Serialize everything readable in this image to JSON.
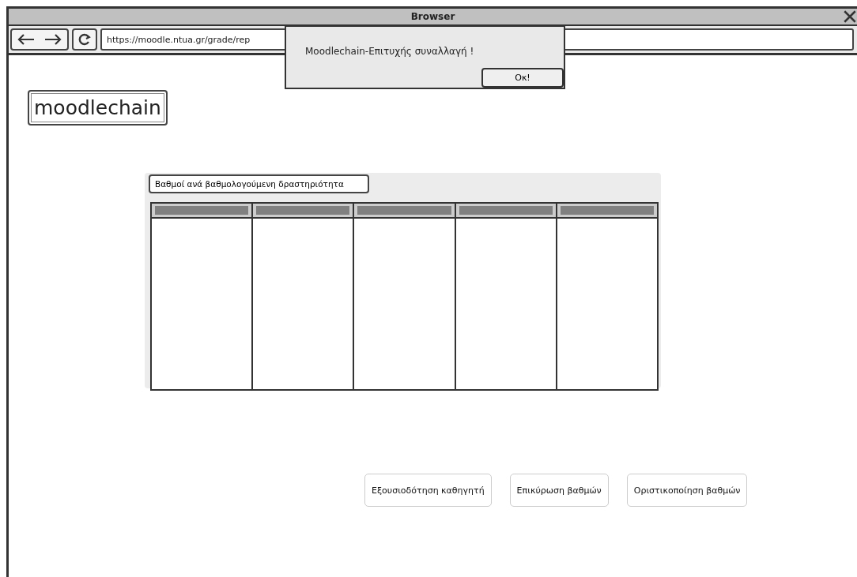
{
  "window": {
    "title": "Browser"
  },
  "toolbar": {
    "url": "https://moodle.ntua.gr/grade/rep"
  },
  "dialog": {
    "message": "Moodlechain-Επιτυχής συναλλαγή !",
    "button": "Οκ!"
  },
  "logo": "moodlechain",
  "panel": {
    "tab": "Βαθμοί ανά βαθμολογούμενη δραστηριότητα"
  },
  "buttons": [
    "Εξουσιοδότηση καθηγητή",
    "Επικύρωση βαθμών",
    "Οριστικοποίηση βαθμών"
  ]
}
